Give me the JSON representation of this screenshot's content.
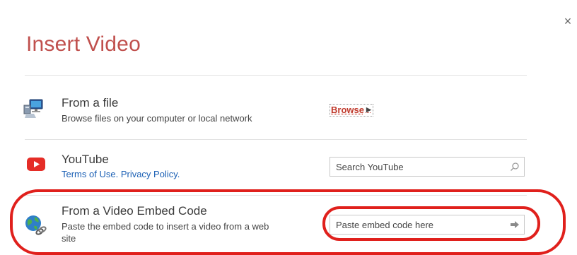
{
  "dialog": {
    "title": "Insert Video",
    "close_label": "×"
  },
  "rows": [
    {
      "title": "From a file",
      "subtitle": "Browse files on your computer or local network",
      "action_label": "Browse",
      "icon": "computer-network-icon"
    },
    {
      "title": "YouTube",
      "links": [
        "Terms of Use.",
        "Privacy Policy."
      ],
      "search_placeholder": "Search YouTube",
      "icon": "youtube-icon"
    },
    {
      "title": "From a Video Embed Code",
      "subtitle_line1": "Paste the embed code to insert a video from a web",
      "subtitle_line2": "site",
      "embed_placeholder": "Paste embed code here",
      "icon": "globe-link-icon"
    }
  ],
  "colors": {
    "title": "#c0504d",
    "highlight": "#e0201c",
    "link": "#1a5fb4",
    "youtube": "#e52d27"
  }
}
